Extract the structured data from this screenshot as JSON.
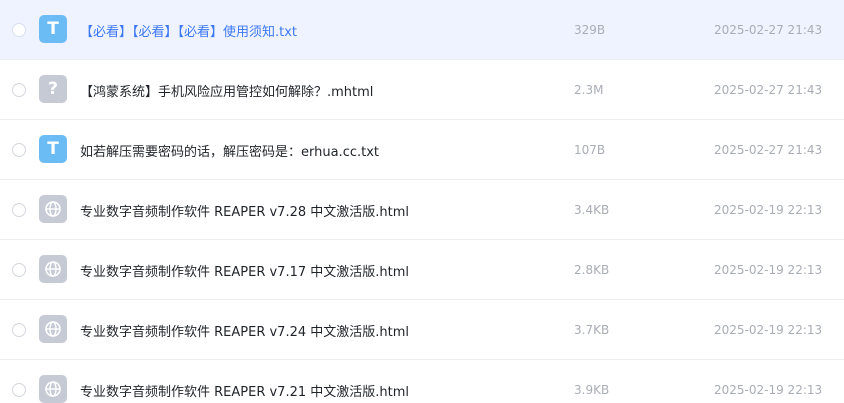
{
  "files": [
    {
      "name": "【必看】【必看】【必看】使用须知.txt",
      "size": "329B",
      "date": "2025-02-27 21:43",
      "icon": "txt-file-icon",
      "icon_glyph": "T",
      "selected": true
    },
    {
      "name": "【鸿蒙系统】手机风险应用管控如何解除？.mhtml",
      "size": "2.3M",
      "date": "2025-02-27 21:43",
      "icon": "unknown-file-icon",
      "icon_glyph": "?",
      "selected": false
    },
    {
      "name": "如若解压需要密码的话，解压密码是：erhua.cc.txt",
      "size": "107B",
      "date": "2025-02-27 21:43",
      "icon": "txt-file-icon",
      "icon_glyph": "T",
      "selected": false
    },
    {
      "name": "专业数字音频制作软件 REAPER v7.28 中文激活版.html",
      "size": "3.4KB",
      "date": "2025-02-19 22:13",
      "icon": "globe-icon",
      "icon_glyph": "",
      "selected": false
    },
    {
      "name": "专业数字音频制作软件 REAPER v7.17 中文激活版.html",
      "size": "2.8KB",
      "date": "2025-02-19 22:13",
      "icon": "globe-icon",
      "icon_glyph": "",
      "selected": false
    },
    {
      "name": "专业数字音频制作软件 REAPER v7.24 中文激活版.html",
      "size": "3.7KB",
      "date": "2025-02-19 22:13",
      "icon": "globe-icon",
      "icon_glyph": "",
      "selected": false
    },
    {
      "name": "专业数字音频制作软件 REAPER v7.21 中文激活版.html",
      "size": "3.9KB",
      "date": "2025-02-19 22:13",
      "icon": "globe-icon",
      "icon_glyph": "",
      "selected": false
    }
  ],
  "colors": {
    "selected_bg": "#eef3ff",
    "selected_text": "#3d78f5",
    "txt_icon": "#6bbcf4",
    "generic_icon": "#c5cad5"
  }
}
